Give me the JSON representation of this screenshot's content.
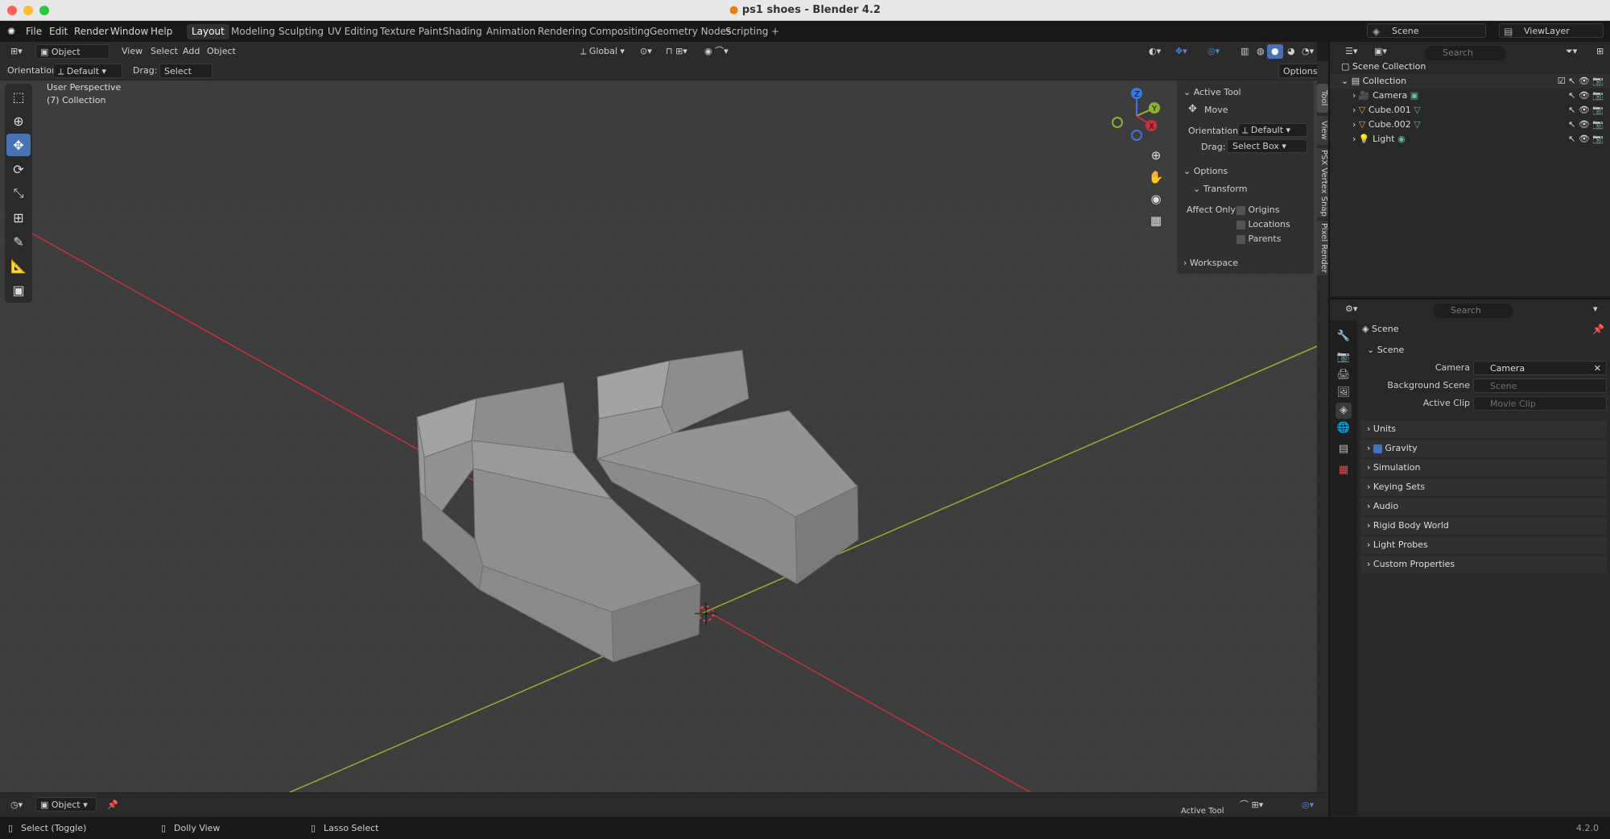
{
  "window": {
    "title": "ps1 shoes - Blender 4.2"
  },
  "menu": [
    "File",
    "Edit",
    "Render",
    "Window",
    "Help"
  ],
  "workspaces": [
    "Layout",
    "Modeling",
    "Sculpting",
    "UV Editing",
    "Texture Paint",
    "Shading",
    "Animation",
    "Rendering",
    "Compositing",
    "Geometry Nodes",
    "Scripting"
  ],
  "add_workspace": "+",
  "header": {
    "mode": "Object Mode",
    "menus": [
      "View",
      "Select",
      "Add",
      "Object"
    ],
    "transform": "Global"
  },
  "toolsettings": {
    "orientation_label": "Orientation:",
    "orientation": "Default",
    "drag_label": "Drag:",
    "drag": "Select Box",
    "options": "Options"
  },
  "viewport": {
    "perspective": "User Perspective",
    "collection": "(7) Collection",
    "gizmo": {
      "z": "Z",
      "y": "Y",
      "x": "X"
    }
  },
  "npanel": {
    "active_tool": "Active Tool",
    "move": "Move",
    "orientation_label": "Orientation",
    "orientation": "Default",
    "drag_label": "Drag:",
    "drag": "Select Box",
    "options": "Options",
    "transform": "Transform",
    "affect_only": "Affect Only",
    "origins": "Origins",
    "locations": "Locations",
    "parents": "Parents",
    "workspace": "Workspace"
  },
  "sidetabs": [
    "Tool",
    "View",
    "PSX Vertex Snap",
    "Pixel Render"
  ],
  "outliner": {
    "scene": "Scene",
    "viewlayer": "ViewLayer",
    "search": "Search",
    "root": "Scene Collection",
    "collection": "Collection",
    "items": [
      "Camera",
      "Cube.001",
      "Cube.002",
      "Light"
    ]
  },
  "properties": {
    "search": "Search",
    "context": "Scene",
    "section": "Scene",
    "camera_label": "Camera",
    "camera": "Camera",
    "bg_label": "Background Scene",
    "bg": "Scene",
    "clip_label": "Active Clip",
    "clip": "Movie Clip",
    "panels": [
      "Units",
      "Gravity",
      "Simulation",
      "Keying Sets",
      "Audio",
      "Rigid Body World",
      "Light Probes",
      "Custom Properties"
    ],
    "gravity_checked": true
  },
  "bottom": {
    "mode": "Object",
    "active_tool_tab": "Active Tool"
  },
  "status": {
    "select": "Select (Toggle)",
    "dolly": "Dolly View",
    "lasso": "Lasso Select",
    "version": "4.2.0"
  },
  "colors": {
    "accent": "#4772b3",
    "viewport": "#3d3d3d",
    "x_axis": "#c8323c",
    "y_axis": "#8cb432",
    "z_axis": "#3c78dc"
  }
}
